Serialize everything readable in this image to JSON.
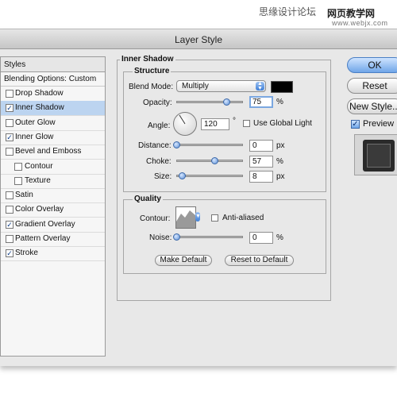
{
  "watermark": {
    "left_text": "思缘设计论坛",
    "right_text": "网页教学网",
    "sub_text": "www.webjx.com"
  },
  "window": {
    "title": "Layer Style"
  },
  "styles_panel": {
    "header": "Styles",
    "blending_options": "Blending Options: Custom",
    "items": [
      {
        "label": "Drop Shadow",
        "checked": false,
        "selected": false,
        "indent": false
      },
      {
        "label": "Inner Shadow",
        "checked": true,
        "selected": true,
        "indent": false
      },
      {
        "label": "Outer Glow",
        "checked": false,
        "selected": false,
        "indent": false
      },
      {
        "label": "Inner Glow",
        "checked": true,
        "selected": false,
        "indent": false
      },
      {
        "label": "Bevel and Emboss",
        "checked": false,
        "selected": false,
        "indent": false
      },
      {
        "label": "Contour",
        "checked": false,
        "selected": false,
        "indent": true
      },
      {
        "label": "Texture",
        "checked": false,
        "selected": false,
        "indent": true
      },
      {
        "label": "Satin",
        "checked": false,
        "selected": false,
        "indent": false
      },
      {
        "label": "Color Overlay",
        "checked": false,
        "selected": false,
        "indent": false
      },
      {
        "label": "Gradient Overlay",
        "checked": true,
        "selected": false,
        "indent": false
      },
      {
        "label": "Pattern Overlay",
        "checked": false,
        "selected": false,
        "indent": false
      },
      {
        "label": "Stroke",
        "checked": true,
        "selected": false,
        "indent": false
      }
    ]
  },
  "inner_shadow": {
    "group_title": "Inner Shadow",
    "structure": {
      "title": "Structure",
      "blend_mode_label": "Blend Mode:",
      "blend_mode_value": "Multiply",
      "shadow_color": "#000000",
      "opacity_label": "Opacity:",
      "opacity_value": "75",
      "opacity_unit": "%",
      "angle_label": "Angle:",
      "angle_value": "120",
      "angle_unit": "°",
      "use_global_light_label": "Use Global Light",
      "use_global_light": false,
      "distance_label": "Distance:",
      "distance_value": "0",
      "distance_unit": "px",
      "choke_label": "Choke:",
      "choke_value": "57",
      "choke_unit": "%",
      "size_label": "Size:",
      "size_value": "8",
      "size_unit": "px"
    },
    "quality": {
      "title": "Quality",
      "contour_label": "Contour:",
      "anti_aliased_label": "Anti-aliased",
      "anti_aliased": false,
      "noise_label": "Noise:",
      "noise_value": "0",
      "noise_unit": "%"
    },
    "make_default": "Make Default",
    "reset_to_default": "Reset to Default"
  },
  "buttons": {
    "ok": "OK",
    "reset": "Reset",
    "new_style": "New Style...",
    "preview_label": "Preview",
    "preview_checked": true
  },
  "colors": {
    "accent": "#6fa5e8",
    "selection": "#bcd4f0",
    "window_bg": "#e8e8e8"
  },
  "slider_levels": {
    "opacity": 0.75,
    "distance": 0.0,
    "choke": 0.57,
    "size": 0.08,
    "noise": 0.0
  }
}
